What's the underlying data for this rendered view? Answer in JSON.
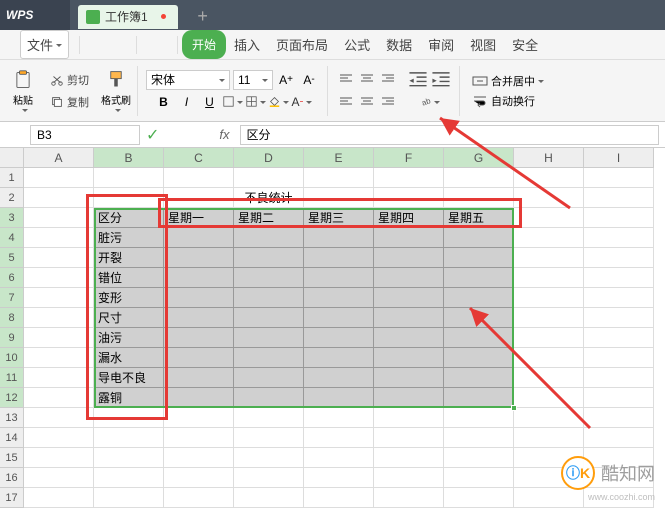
{
  "app": {
    "logo": "WPS",
    "doc_tab": "工作簿1"
  },
  "menu": {
    "file": "文件",
    "start": "开始",
    "items": [
      "插入",
      "页面布局",
      "公式",
      "数据",
      "审阅",
      "视图",
      "安全"
    ]
  },
  "ribbon": {
    "paste": "粘贴",
    "cut": "剪切",
    "copy": "复制",
    "format_painter": "格式刷",
    "font_name": "宋体",
    "font_size": "11",
    "merge": "合并居中",
    "wrap": "自动换行"
  },
  "namebox": "B3",
  "formula": "区分",
  "columns": [
    "A",
    "B",
    "C",
    "D",
    "E",
    "F",
    "G",
    "H",
    "I"
  ],
  "rows": 17,
  "sheet": {
    "title": "不良统计",
    "row_headers": [
      "区分",
      "脏污",
      "开裂",
      "错位",
      "变形",
      "尺寸",
      "油污",
      "漏水",
      "导电不良",
      "露铜"
    ],
    "col_headers": [
      "星期一",
      "星期二",
      "星期三",
      "星期四",
      "星期五"
    ]
  },
  "watermark": {
    "name": "酷知网",
    "url": "www.coozhi.com",
    "logo": "ⓘK"
  }
}
